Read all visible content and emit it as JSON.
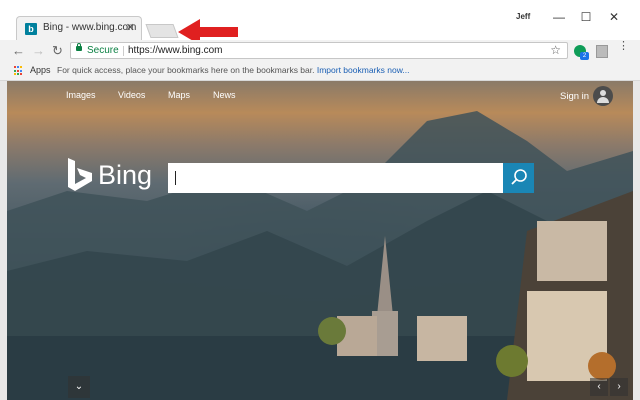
{
  "tab": {
    "title": "Bing - www.bing.com",
    "favicon": "b",
    "close": "✕"
  },
  "window": {
    "user": "Jeff",
    "minimize": "—",
    "maximize": "☐",
    "close": "✕"
  },
  "toolbar": {
    "back": "←",
    "forward": "→",
    "reload": "↻",
    "secure_label": "Secure",
    "url": "https://www.bing.com",
    "star": "☆",
    "menu": "⋮",
    "ext_badge": "2"
  },
  "bookmarks": {
    "apps_label": "Apps",
    "hint": "For quick access, place your bookmarks here on the bookmarks bar.",
    "import_link": "Import bookmarks now..."
  },
  "bing": {
    "nav": [
      "Images",
      "Videos",
      "Maps",
      "News"
    ],
    "signin": "Sign in",
    "logo_text": "Bing",
    "search_placeholder": "",
    "down_arrow": "⌄",
    "prev": "‹",
    "next": "›"
  },
  "colors": {
    "bing_accent": "#1a86b5",
    "arrow_red": "#e02020",
    "secure_green": "#0b8043"
  }
}
